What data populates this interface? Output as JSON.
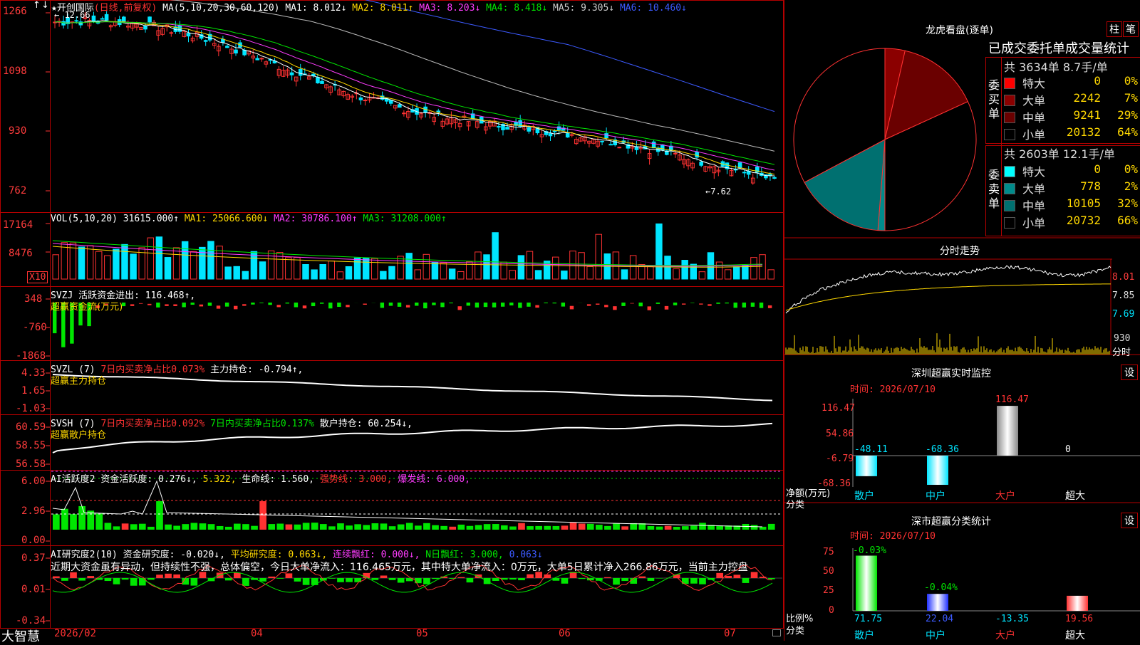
{
  "colors": {
    "up": "#ff3232",
    "down": "#00e5ff",
    "vol_up": "#ff3232",
    "vol_down": "#00e5ff",
    "frame": "#b40000"
  },
  "main": {
    "title": "★开创国际",
    "period": "(日线,前复权)",
    "ma_label": "MA(5,10,20,30,60,120)",
    "ma1": "MA1: 8.012↓",
    "ma2": "MA2: 8.011↑",
    "ma3": "MA3: 8.203↓",
    "ma4": "MA4: 8.418↓",
    "ma5": "MA5: 9.305↓",
    "ma6": "MA6: 10.460↓",
    "high_mark": "12.66",
    "low_mark": "7.62",
    "yticks": [
      "1266",
      "1098",
      "930",
      "762"
    ]
  },
  "vol": {
    "label": "VOL(5,10,20)",
    "value": "31615.000↑",
    "ma1": "MA1: 25066.600↓",
    "ma2": "MA2: 30786.100↑",
    "ma3": "MA3: 31208.000↑",
    "yticks": [
      "17164",
      "8476"
    ],
    "unit": "X10"
  },
  "svzj": {
    "label": "SVZJ",
    "desc": "活跃资金进出: 116.468↑,",
    "sub": "超赢资金流(万元)",
    "yticks": [
      "348",
      "-760",
      "-1868"
    ]
  },
  "svzl": {
    "label": "SVZL (7)",
    "pct": "7日内买卖净占比0.073%",
    "pos": "主力持仓: -0.794↑,",
    "sub": "超赢主力持仓",
    "yticks": [
      "4.33",
      "1.65",
      "-1.03"
    ]
  },
  "svsh": {
    "label": "SVSH (7)",
    "pct1": "7日内买卖净占比0.092%",
    "pct2": "7日内买卖净占比0.137%",
    "pos": "散户持仓: 60.254↓,",
    "sub": "超赢散户持仓",
    "yticks": [
      "60.59",
      "58.55",
      "56.58"
    ]
  },
  "ai1": {
    "label": "AI活跃度2",
    "v1": "资金活跃度: 0.276↓,",
    "v2": "5.322,",
    "v3": "生命线: 1.560,",
    "v4": "强势线: 3.000,",
    "v5": "爆发线: 6.000,",
    "yticks": [
      "6.00",
      "2.96",
      "0.00"
    ]
  },
  "ai2": {
    "label": "AI研究度2(10)",
    "v1": "资金研究度: -0.020↓,",
    "v2": "平均研究度: 0.063↓,",
    "v3": "连续飘红: 0.000↓,",
    "v4": "N日飘红: 3.000,",
    "v5": "0.063↓",
    "comment": "近期大资金虽有异动，但持续性不强，总体偏空，今日大单净流入：116.465万元，其中特大单净流入：0万元，大单5日累计净入266.86万元，当前主力控盘",
    "yticks": [
      "0.37",
      "0.01",
      "-0.34"
    ]
  },
  "xaxis": {
    "brand": "大智慧",
    "labels": [
      "2026/02",
      "04",
      "05",
      "06",
      "07"
    ]
  },
  "dragon": {
    "title": "龙虎看盘(逐单)",
    "btn1": "柱",
    "btn2": "笔",
    "heading": "已成交委托单成交量统计",
    "buy_side": "委买单",
    "sell_side": "委卖单",
    "buy_total": "共 3634单 8.7手/单",
    "sell_total": "共 2603单 12.1手/单",
    "buy_rows": [
      {
        "name": "特大",
        "count": "0",
        "pct": "0%",
        "color": "#ff0000"
      },
      {
        "name": "大单",
        "count": "2242",
        "pct": "7%",
        "color": "#8b0000"
      },
      {
        "name": "中单",
        "count": "9241",
        "pct": "29%",
        "color": "#6a0000"
      },
      {
        "name": "小单",
        "count": "20132",
        "pct": "64%",
        "color": "#000000"
      }
    ],
    "sell_rows": [
      {
        "name": "特大",
        "count": "0",
        "pct": "0%",
        "color": "#00ffff"
      },
      {
        "name": "大单",
        "count": "778",
        "pct": "2%",
        "color": "#008b8b"
      },
      {
        "name": "中单",
        "count": "10105",
        "pct": "32%",
        "color": "#007070"
      },
      {
        "name": "小单",
        "count": "20732",
        "pct": "66%",
        "color": "#000000"
      }
    ]
  },
  "intraday": {
    "title": "分时走势",
    "yticks": [
      "8.01",
      "7.85",
      "7.69"
    ],
    "vol_tick": "930",
    "unit": "分时"
  },
  "sz_monitor": {
    "title": "深圳超赢实时监控",
    "btn": "设",
    "time": "时间: 2026/07/10",
    "yticks": [
      "116.47",
      "54.86",
      "-6.79",
      "-68.36"
    ],
    "ylabel": "净额(万元)",
    "xlabel": "分类",
    "categories": [
      "散户",
      "中户",
      "大户",
      "超大"
    ],
    "values": [
      -48.11,
      -68.36,
      116.47,
      0
    ],
    "value_labels": [
      "-48.11",
      "-68.36",
      "116.47",
      "0"
    ]
  },
  "sz_class": {
    "title": "深市超赢分类统计",
    "btn": "设",
    "time": "时间: 2026/07/10",
    "yticks": [
      "75",
      "50",
      "25",
      "0"
    ],
    "ylabel": "比例%",
    "xlabel": "分类",
    "categories": [
      "散户",
      "中户",
      "大户",
      "超大"
    ],
    "values": [
      71.75,
      22.04,
      -13.35,
      19.56
    ],
    "value_labels": [
      "71.75",
      "22.04",
      "-13.35",
      "19.56"
    ],
    "top_labels": [
      "-0.03%",
      "-0.04%"
    ]
  },
  "chart_data": [
    {
      "type": "bar",
      "title": "深圳超赢实时监控",
      "categories": [
        "散户",
        "中户",
        "大户",
        "超大"
      ],
      "values": [
        -48.11,
        -68.36,
        116.47,
        0
      ],
      "ylabel": "净额(万元)",
      "xlabel": "分类"
    },
    {
      "type": "bar",
      "title": "深市超赢分类统计",
      "categories": [
        "散户",
        "中户",
        "大户",
        "超大"
      ],
      "values": [
        71.75,
        22.04,
        -13.35,
        19.56
      ],
      "ylabel": "比例%",
      "xlabel": "分类"
    },
    {
      "type": "pie",
      "title": "龙虎看盘(逐单)",
      "categories": [
        "特大(买)",
        "大单(买)",
        "中单(买)",
        "小单(买)",
        "特大(卖)",
        "大单(卖)",
        "中单(卖)",
        "小单(卖)"
      ],
      "values": [
        0,
        2242,
        9241,
        20132,
        0,
        778,
        10105,
        20732
      ]
    }
  ]
}
